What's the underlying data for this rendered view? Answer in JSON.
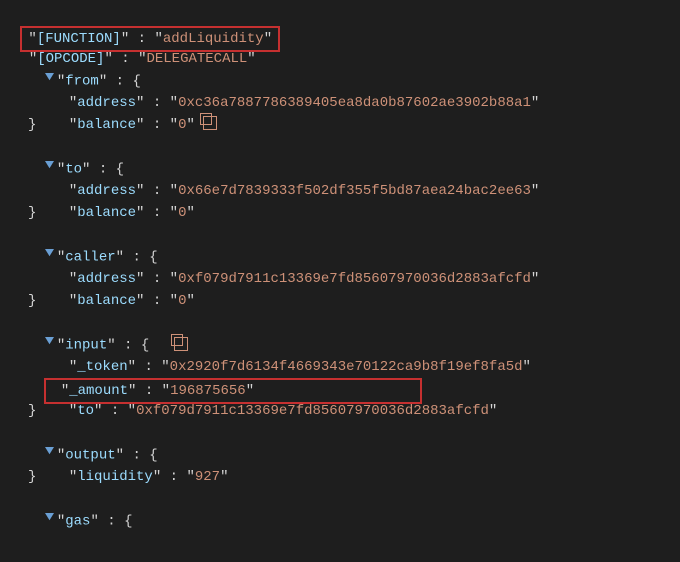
{
  "root": {
    "function_key": "[FUNCTION]",
    "function_val": "addLiquidity",
    "opcode_key": "[OPCODE]",
    "opcode_val": "DELEGATECALL",
    "from": {
      "key": "from",
      "address_key": "address",
      "address": "0xc36a7887786389405ea8da0b87602ae3902b88a1",
      "balance_key": "balance",
      "balance": "0"
    },
    "to": {
      "key": "to",
      "address_key": "address",
      "address": "0x66e7d7839333f502df355f5bd87aea24bac2ee63",
      "balance_key": "balance",
      "balance": "0"
    },
    "caller": {
      "key": "caller",
      "address_key": "address",
      "address": "0xf079d7911c13369e7fd85607970036d2883afcfd",
      "balance_key": "balance",
      "balance": "0"
    },
    "input": {
      "key": "input",
      "token_key": "_token",
      "token": "0x2920f7d6134f4669343e70122ca9b8f19ef8fa5d",
      "amount_key": "_amount",
      "amount": "196875656",
      "to_key": "to",
      "to": "0xf079d7911c13369e7fd85607970036d2883afcfd"
    },
    "output": {
      "key": "output",
      "liquidity_key": "liquidity",
      "liquidity": "927"
    },
    "gas_key": "gas"
  }
}
